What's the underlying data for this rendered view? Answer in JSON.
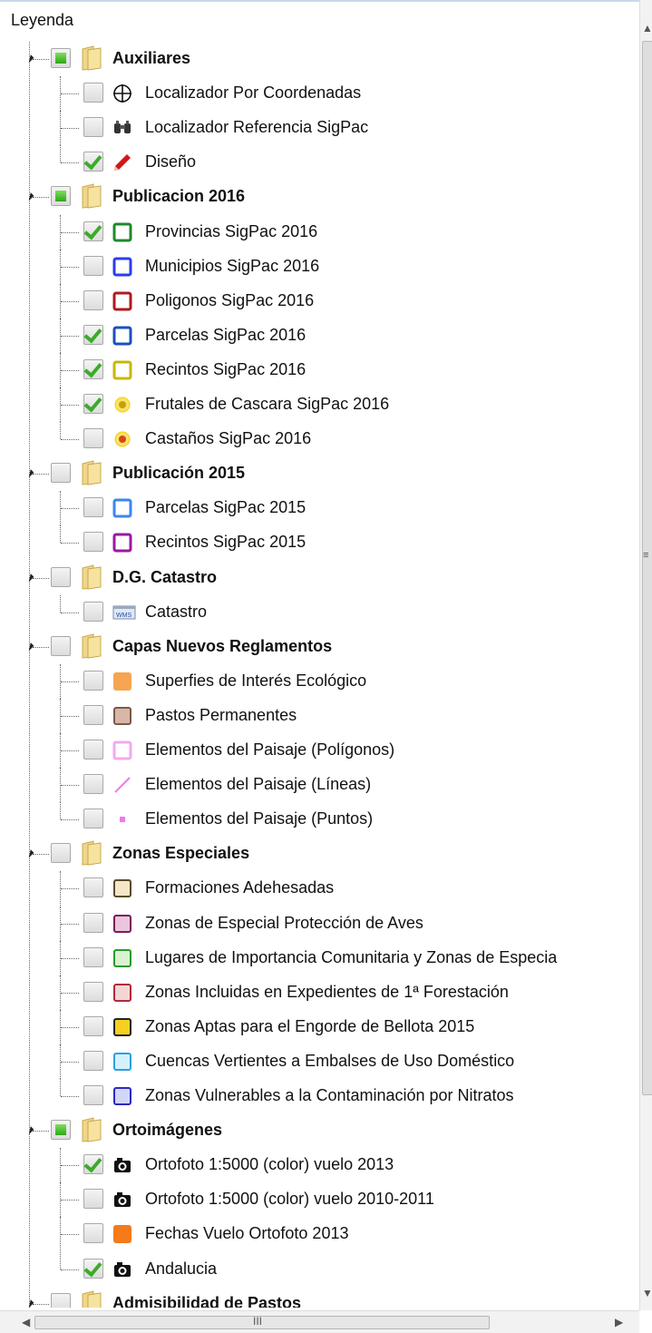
{
  "panel": {
    "title": "Leyenda"
  },
  "rows": [
    {
      "type": "group",
      "label": "Auxiliares",
      "check": "partial"
    },
    {
      "type": "layer",
      "label": "Localizador Por Coordenadas",
      "check": "none",
      "icon": "crosshair-icon"
    },
    {
      "type": "layer",
      "label": "Localizador Referencia SigPac",
      "check": "none",
      "icon": "binoculars-icon"
    },
    {
      "type": "layer",
      "label": "Diseño",
      "check": "checked",
      "icon": "pencil-icon"
    },
    {
      "type": "group",
      "label": "Publicacion 2016",
      "check": "partial"
    },
    {
      "type": "layer",
      "label": "Provincias SigPac 2016",
      "check": "checked",
      "icon": "square-outline-icon",
      "color": "#1e8a2a"
    },
    {
      "type": "layer",
      "label": "Municipios SigPac 2016",
      "check": "none",
      "icon": "square-outline-icon",
      "color": "#2a3df0"
    },
    {
      "type": "layer",
      "label": "Poligonos SigPac 2016",
      "check": "none",
      "icon": "square-outline-icon",
      "color": "#b0191e"
    },
    {
      "type": "layer",
      "label": "Parcelas SigPac 2016",
      "check": "checked",
      "icon": "square-outline-icon",
      "color": "#1a4fc0"
    },
    {
      "type": "layer",
      "label": "Recintos SigPac 2016",
      "check": "checked",
      "icon": "square-outline-icon",
      "color": "#c8b800"
    },
    {
      "type": "layer",
      "label": "Frutales de Cascara SigPac 2016",
      "check": "checked",
      "icon": "dot-icon",
      "color": "#e0a100",
      "inner": "#c8a000"
    },
    {
      "type": "layer",
      "label": "Castaños SigPac 2016",
      "check": "none",
      "icon": "dot-icon",
      "color": "#f2c200",
      "inner": "#d9461a"
    },
    {
      "type": "group",
      "label": "Publicación 2015",
      "check": "none"
    },
    {
      "type": "layer",
      "label": "Parcelas SigPac 2015",
      "check": "none",
      "icon": "square-outline-icon",
      "color": "#3a86f5"
    },
    {
      "type": "layer",
      "label": "Recintos SigPac 2015",
      "check": "none",
      "icon": "square-outline-icon",
      "color": "#9a1aa0"
    },
    {
      "type": "group",
      "label": "D.G. Catastro",
      "check": "none"
    },
    {
      "type": "layer",
      "label": "Catastro",
      "check": "none",
      "icon": "map-thumbnail-icon"
    },
    {
      "type": "group",
      "label": "Capas Nuevos Reglamentos",
      "check": "none"
    },
    {
      "type": "layer",
      "label": "Superfies de Interés Ecológico",
      "check": "none",
      "icon": "square-filled-icon",
      "color": "#f6a552",
      "fill": "#f6a552"
    },
    {
      "type": "layer",
      "label": "Pastos Permanentes",
      "check": "none",
      "icon": "square-filled-icon",
      "color": "#7a5a4a",
      "fill": "#d8b6a8"
    },
    {
      "type": "layer",
      "label": "Elementos del Paisaje (Polígonos)",
      "check": "none",
      "icon": "square-outline-icon",
      "color": "#f4a8f0"
    },
    {
      "type": "layer",
      "label": "Elementos del Paisaje (Líneas)",
      "check": "none",
      "icon": "line-icon",
      "color": "#f07ae8"
    },
    {
      "type": "layer",
      "label": "Elementos del Paisaje (Puntos)",
      "check": "none",
      "icon": "point-icon",
      "color": "#f07ae8"
    },
    {
      "type": "group",
      "label": "Zonas Especiales",
      "check": "none"
    },
    {
      "type": "layer",
      "label": "Formaciones Adehesadas",
      "check": "none",
      "icon": "square-filled-icon",
      "color": "#5a4a2a",
      "fill": "#f5e6c8"
    },
    {
      "type": "layer",
      "label": "Zonas de Especial Protección de Aves",
      "check": "none",
      "icon": "square-filled-icon",
      "color": "#7a1a5a",
      "fill": "#e9c6dc"
    },
    {
      "type": "layer",
      "label": "Lugares de Importancia Comunitaria y Zonas de Especia",
      "check": "none",
      "icon": "square-filled-icon",
      "color": "#2a9a2a",
      "fill": "#d8f2d2"
    },
    {
      "type": "layer",
      "label": "Zonas Incluidas en Expedientes de 1ª Forestación",
      "check": "none",
      "icon": "square-filled-icon",
      "color": "#b02a3a",
      "fill": "#f2d6d6"
    },
    {
      "type": "layer",
      "label": "Zonas Aptas para el Engorde de Bellota 2015",
      "check": "none",
      "icon": "square-filled-icon",
      "color": "#222222",
      "fill": "#f5d020"
    },
    {
      "type": "layer",
      "label": "Cuencas Vertientes a Embalses de Uso Doméstico",
      "check": "none",
      "icon": "square-filled-icon",
      "color": "#2aa0e0",
      "fill": "#d6f0fc"
    },
    {
      "type": "layer",
      "label": "Zonas Vulnerables a la Contaminación por Nitratos",
      "check": "none",
      "icon": "square-filled-icon",
      "color": "#2a2ac0",
      "fill": "#d2d6f8"
    },
    {
      "type": "group",
      "label": "Ortoimágenes",
      "check": "partial"
    },
    {
      "type": "layer",
      "label": "Ortofoto 1:5000 (color) vuelo 2013",
      "check": "checked",
      "icon": "camera-icon"
    },
    {
      "type": "layer",
      "label": "Ortofoto 1:5000 (color) vuelo 2010-2011",
      "check": "none",
      "icon": "camera-icon"
    },
    {
      "type": "layer",
      "label": "Fechas Vuelo Ortofoto 2013",
      "check": "none",
      "icon": "square-filled-icon",
      "color": "#f47a1a",
      "fill": "#f47a1a"
    },
    {
      "type": "layer",
      "label": "Andalucia",
      "check": "checked",
      "icon": "camera-icon"
    },
    {
      "type": "group",
      "label": "Admisibilidad de Pastos",
      "check": "none"
    }
  ],
  "scrollbar": {
    "h_thumb_glyph": "III",
    "v_thumb_glyph": "≡"
  }
}
